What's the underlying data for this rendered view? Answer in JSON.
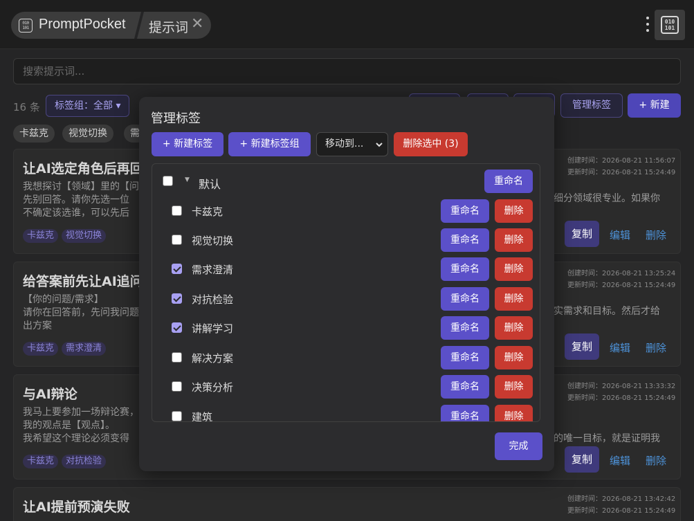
{
  "titlebar": {
    "app_name": "PromptPocket",
    "app_icon_glyph": "010\n101",
    "tab_label": "提示词",
    "close_glyph": "✕",
    "binary_glyph": "010\n101"
  },
  "search": {
    "placeholder": "搜索提示词..."
  },
  "filter": {
    "count": "16 条",
    "group_filter": "标签组：全部 ▾",
    "manage_tags": "管理标签",
    "new_button": "+ 新建"
  },
  "tag_chips": [
    "卡兹克",
    "视觉切换",
    "需"
  ],
  "cards": [
    {
      "title": "让AI选定角色后再回",
      "body_left": "我想探讨【领域】里的【问\n先别回答。请你先选一位\n不确定该选谁，可以先后\n",
      "body_right": "细分领域很专业。如果你",
      "created": "创建时间：2026-08-21 11:56:07",
      "updated": "更新时间：2026-08-21 15:24:49",
      "tags": [
        "卡兹克",
        "视觉切换"
      ],
      "copy": "复制",
      "edit": "编辑",
      "delete": "删除"
    },
    {
      "title": "给答案前先让AI追问",
      "body_left": "【你的问题/需求】\n请你在回答前，先问我问题\n出方案",
      "body_right": "实需求和目标。然后才给",
      "created": "创建时间：2026-08-21 13:25:24",
      "updated": "更新时间：2026-08-21 15:24:49",
      "tags": [
        "卡兹克",
        "需求澄清"
      ],
      "copy": "复制",
      "edit": "编辑",
      "delete": "删除"
    },
    {
      "title": "与AI辩论",
      "body_left": "我马上要参加一场辩论赛，\n我的观点是【观点】。\n我希望这个理论必须变得",
      "body_right": "的唯一目标，就是证明我",
      "created": "创建时间：2026-08-21 13:33:32",
      "updated": "更新时间：2026-08-21 15:24:49",
      "tags": [
        "卡兹克",
        "对抗检验"
      ],
      "copy": "复制",
      "edit": "编辑",
      "delete": "删除"
    },
    {
      "title": "让AI提前预演失败",
      "created": "创建时间：2026-08-21 13:42:42",
      "updated": "更新时间：2026-08-21 15:24:49"
    }
  ],
  "modal": {
    "title": "管理标签",
    "new_tag": "+ 新建标签",
    "new_group": "+ 新建标签组",
    "move_to": "移动到...",
    "delete_selected": "删除选中 (3)",
    "group": {
      "name": "默认",
      "rename": "重命名",
      "checked": false
    },
    "tags": [
      {
        "name": "卡兹克",
        "checked": false,
        "rename": "重命名",
        "delete": "删除"
      },
      {
        "name": "视觉切换",
        "checked": false,
        "rename": "重命名",
        "delete": "删除"
      },
      {
        "name": "需求澄清",
        "checked": true,
        "rename": "重命名",
        "delete": "删除"
      },
      {
        "name": "对抗检验",
        "checked": true,
        "rename": "重命名",
        "delete": "删除"
      },
      {
        "name": "讲解学习",
        "checked": true,
        "rename": "重命名",
        "delete": "删除"
      },
      {
        "name": "解决方案",
        "checked": false,
        "rename": "重命名",
        "delete": "删除"
      },
      {
        "name": "决策分析",
        "checked": false,
        "rename": "重命名",
        "delete": "删除"
      },
      {
        "name": "建筑",
        "checked": false,
        "rename": "重命名",
        "delete": "删除"
      }
    ],
    "done": "完成"
  },
  "colors": {
    "accent": "#5b50c9",
    "danger": "#c83a30",
    "link": "#4d92d8",
    "background": "#252526"
  }
}
